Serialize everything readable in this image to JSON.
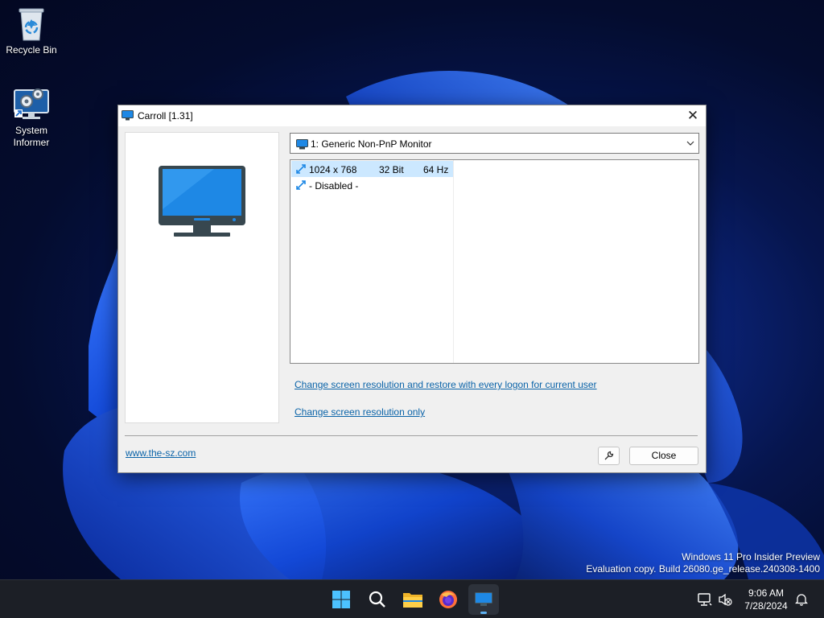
{
  "desktop": {
    "icons": [
      {
        "label": "Recycle Bin",
        "icon": "recycle-bin-icon"
      },
      {
        "label_line1": "System",
        "label_line2": "Informer",
        "icon": "system-informer-icon"
      }
    ],
    "watermark": {
      "line1": "Windows 11 Pro Insider Preview",
      "line2": "Evaluation copy. Build 26080.ge_release.240308-1400"
    }
  },
  "dialog": {
    "title": "Carroll [1.31]",
    "close_glyph": "✕",
    "monitor_select": {
      "value": "1: Generic Non-PnP Monitor"
    },
    "modes": [
      {
        "resolution": "1024 x 768",
        "bit": "32 Bit",
        "hz": "64 Hz",
        "selected": true
      },
      {
        "resolution": "- Disabled -",
        "bit": "",
        "hz": "",
        "selected": false
      }
    ],
    "link_restore": "Change screen resolution and restore with every logon for current user",
    "link_only": "Change screen resolution only",
    "site_link": "www.the-sz.com",
    "close_label": "Close"
  },
  "taskbar": {
    "items": [
      "start-icon",
      "search-icon",
      "file-explorer-icon",
      "firefox-icon",
      "carroll-icon"
    ],
    "active_item": "carroll-icon",
    "clock": {
      "time": "9:06 AM",
      "date": "7/28/2024"
    }
  },
  "colors": {
    "accent": "#0078d4",
    "selection": "#cce8ff",
    "link": "#0a63a8",
    "taskbar": "#1c1f26"
  }
}
